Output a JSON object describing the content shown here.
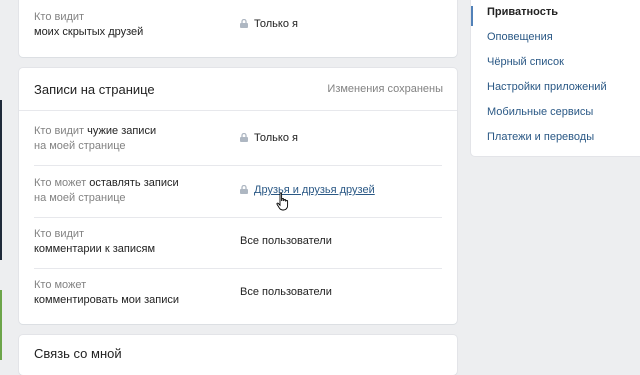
{
  "hidden_friends_section": {
    "label_line1": "Кто видит",
    "label_line2": "моих скрытых друзей",
    "value": "Только я"
  },
  "wall_section": {
    "title": "Записи на странице",
    "status": "Изменения сохранены",
    "rows": [
      {
        "line1_prefix": "Кто видит ",
        "line1_bold": "чужие записи",
        "line2": "на моей странице",
        "value": "Только я"
      },
      {
        "line1_prefix": "Кто может ",
        "line1_bold": "оставлять записи",
        "line2": "на моей странице",
        "value": "Друзья и друзья друзей"
      },
      {
        "line1": "Кто видит",
        "line2_bold": "комментарии к записям",
        "value": "Все пользователи"
      },
      {
        "line1": "Кто может",
        "line2_bold": "комментировать мои записи",
        "value": "Все пользователи"
      }
    ]
  },
  "next_section": {
    "title": "Связь со мной"
  },
  "settings_menu": {
    "items": [
      {
        "label": "Приватность"
      },
      {
        "label": "Оповещения"
      },
      {
        "label": "Чёрный список"
      },
      {
        "label": "Настройки приложений"
      },
      {
        "label": "Мобильные сервисы"
      },
      {
        "label": "Платежи и переводы"
      }
    ]
  },
  "colors": {
    "link": "#2a5885",
    "accent": "#5181b8",
    "background": "#edeef0"
  }
}
